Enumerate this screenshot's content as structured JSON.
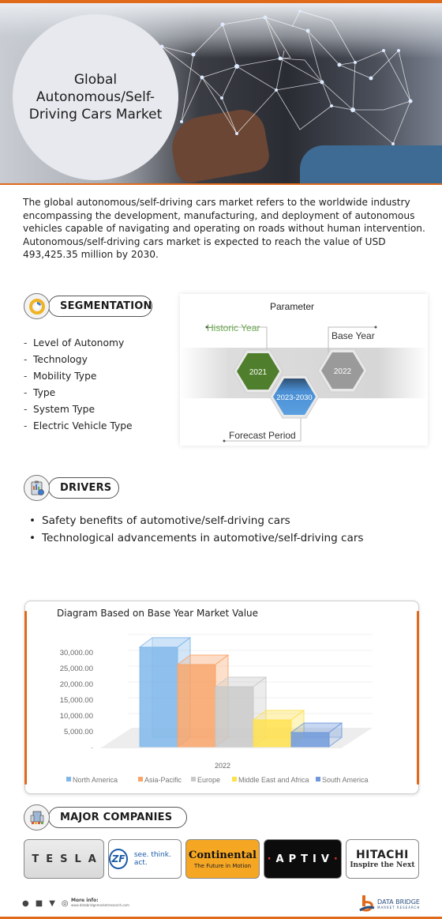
{
  "hero": {
    "title": "Global Autonomous/Self-Driving Cars Market"
  },
  "intro": {
    "text": "The global autonomous/self-driving cars market refers to the worldwide industry encompassing the development, manufacturing, and deployment of autonomous vehicles capable of navigating and operating on roads without human intervention. Autonomous/self-driving cars market is expected to reach the value of USD 493,425.35 million by 2030."
  },
  "segmentation": {
    "heading": "SEGMENTATION",
    "icon": "pie-gear-icon",
    "items": [
      "Level of Autonomy",
      "Technology",
      "Mobility Type",
      "Type",
      "System Type",
      "Electric Vehicle Type"
    ]
  },
  "parameter": {
    "title": "Parameter",
    "historic_label": "Historic Year",
    "historic_value": "2021",
    "base_label": "Base Year",
    "base_value": "2022",
    "forecast_label": "Forecast Period",
    "forecast_value": "2023-2030",
    "colors": {
      "historic": "#4f7f2c",
      "forecast": "#4a8fd3",
      "base": "#9a9a9a",
      "historic_text": "#6aa84f"
    }
  },
  "drivers": {
    "heading": "DRIVERS",
    "icon": "clipboard-chart-icon",
    "items": [
      "Safety benefits of automotive/self-driving cars",
      "Technological advancements in automotive/self-driving cars"
    ]
  },
  "chart_data": {
    "type": "bar",
    "title": "Diagram Based on Base Year Market Value",
    "categories": [
      "2022"
    ],
    "xlabel": "2022",
    "ylabel": "",
    "ylim": [
      0,
      30000
    ],
    "yticks": [
      "",
      "5,000.00",
      "10,000.00",
      "15,000.00",
      "20,000.00",
      "25,000.00",
      "30,000.00"
    ],
    "grid": true,
    "legend_position": "bottom",
    "series": [
      {
        "name": "North America",
        "values": [
          31500
        ],
        "color": "#7fb7ea"
      },
      {
        "name": "Asia-Pacific",
        "values": [
          26000
        ],
        "color": "#f8a46a"
      },
      {
        "name": "Europe",
        "values": [
          19000
        ],
        "color": "#c9c9c9"
      },
      {
        "name": "Middle East and Africa",
        "values": [
          8500
        ],
        "color": "#ffe14d"
      },
      {
        "name": "South America",
        "values": [
          4500
        ],
        "color": "#6f99db"
      }
    ]
  },
  "companies": {
    "heading": "MAJOR COMPANIES",
    "icon": "buildings-icon",
    "items": [
      {
        "name": "TESLA"
      },
      {
        "name": "ZF",
        "tagline": "see. think. act."
      },
      {
        "name": "Continental",
        "tagline": "The Future in Motion"
      },
      {
        "name": "APTIV"
      },
      {
        "name": "HITACHI",
        "tagline": "Inspire the Next"
      }
    ]
  },
  "footer": {
    "more_info_label": "More info:",
    "more_info_url": "www.databridgemarketresearch.com",
    "brand_name": "DATA BRIDGE",
    "brand_sub": "MARKET RESEARCH",
    "social_icons": [
      "whatsapp-icon",
      "facebook-icon",
      "twitter-icon",
      "instagram-icon"
    ]
  },
  "colors": {
    "accent": "#e06a1b"
  }
}
